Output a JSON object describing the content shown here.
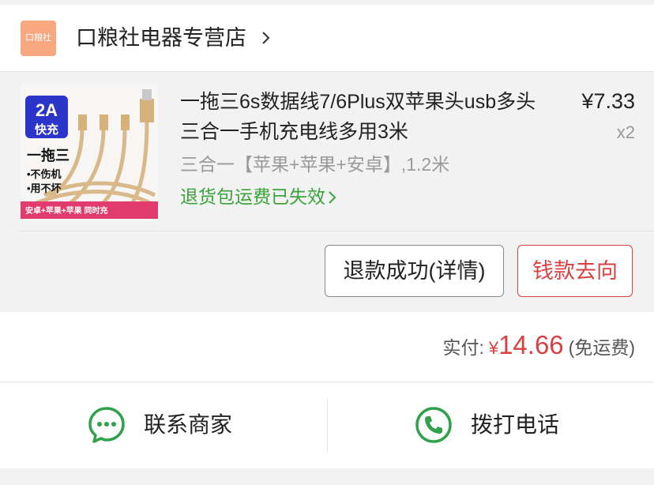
{
  "shop": {
    "logo_text": "口粮社",
    "name": "口粮社电器专营店",
    "chevron_icon": "chevron-right-icon"
  },
  "item": {
    "title": "一拖三6s数据线7/6Plus双苹果头usb多头三合一手机充电线多用3米",
    "price": "¥7.33",
    "quantity": "x2",
    "spec": "三合一【苹果+苹果+安卓】,1.2米",
    "notice": "退货包运费已失效",
    "thumb_text": {
      "badge_top": "2A",
      "badge_bottom": "快充",
      "line1": "一拖三",
      "line2": "•不伤机",
      "line3": "•用不坏",
      "banner": "安卓+苹果+苹果  同时充"
    }
  },
  "actions": {
    "refund_label": "退款成功(详情)",
    "money_label": "钱款去向"
  },
  "payment": {
    "label": "实付:",
    "currency": "¥",
    "amount": "14.66",
    "note": "(免运费)"
  },
  "contact": {
    "seller_label": "联系商家",
    "seller_icon": "chat-bubble-icon",
    "call_label": "拨打电话",
    "call_icon": "phone-icon"
  },
  "colors": {
    "accent_red": "#d94040",
    "green": "#3aa33a",
    "logo_bg": "#f8a77f",
    "muted": "#9a9a9a"
  }
}
